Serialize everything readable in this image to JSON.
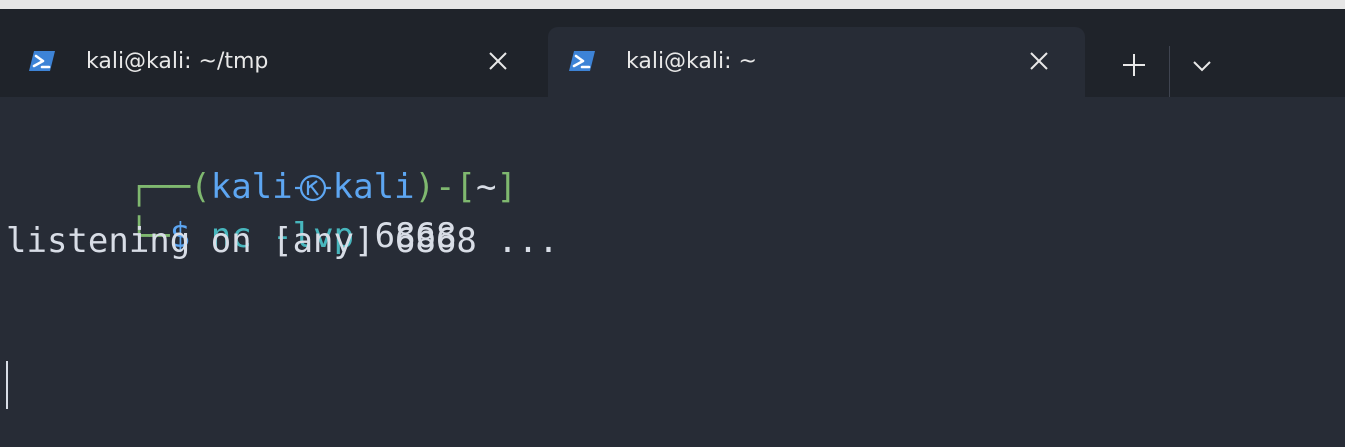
{
  "tabs": [
    {
      "title": "kali@kali: ~/tmp",
      "active": false,
      "icon": "powershell-icon"
    },
    {
      "title": "kali@kali: ~",
      "active": true,
      "icon": "powershell-icon"
    }
  ],
  "tabbar": {
    "new_tab_label": "+",
    "dropdown_icon": "chevron-down-icon",
    "close_icon": "close-icon"
  },
  "terminal": {
    "prompt": {
      "corner_top": "┌──",
      "open_paren": "(",
      "user": "kali",
      "host": "kali",
      "close_paren": ")",
      "dash": "-",
      "open_bracket": "[",
      "cwd": "~",
      "close_bracket": "]",
      "corner_bottom": "└─",
      "symbol": "$"
    },
    "command": {
      "name": "nc",
      "flags": "-lvp",
      "port": "6868"
    },
    "output": [
      "listening on [any] 6868 ..."
    ]
  },
  "colors": {
    "background": "#272c36",
    "tabbar_background": "#1f232a",
    "prompt_green": "#7fb86f",
    "prompt_blue": "#5da6f2",
    "command_cyan": "#47b6bd",
    "text": "#d8dde6"
  }
}
